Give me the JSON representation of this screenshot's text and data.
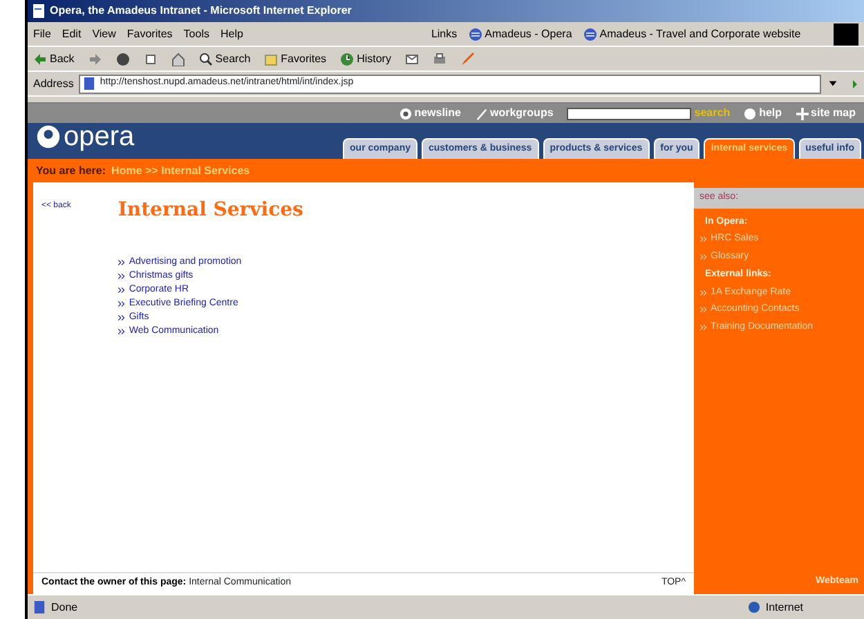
{
  "window": {
    "title": "Opera, the Amadeus Intranet - Microsoft Internet Explorer"
  },
  "menu": [
    "File",
    "Edit",
    "View",
    "Favorites",
    "Tools",
    "Help"
  ],
  "links_bar": {
    "label": "Links",
    "items": [
      "Amadeus - Opera",
      "Amadeus - Travel and Corporate website"
    ]
  },
  "toolbar": [
    {
      "kind": "back",
      "label": "Back"
    },
    {
      "kind": "forward"
    },
    {
      "kind": "stop"
    },
    {
      "kind": "refresh"
    },
    {
      "kind": "home"
    },
    {
      "kind": "search",
      "label": "Search"
    },
    {
      "kind": "favorites",
      "label": "Favorites"
    },
    {
      "kind": "history",
      "label": "History"
    },
    {
      "kind": "mail"
    },
    {
      "kind": "print"
    },
    {
      "kind": "edit"
    }
  ],
  "address": {
    "label": "Address",
    "value": "http://tenshost.nupd.amadeus.net/intranet/html/int/index.jsp"
  },
  "site": {
    "logo": "opera",
    "nav": [
      {
        "kind": "newsline",
        "label": "newsline"
      },
      {
        "kind": "workgroups",
        "label": "workgroups"
      },
      {
        "kind": "search",
        "label": "search"
      },
      {
        "kind": "help",
        "label": "help"
      },
      {
        "kind": "sitemap",
        "label": "site map"
      }
    ],
    "tabs": [
      {
        "label": "our company",
        "selected": false
      },
      {
        "label": "customers & business",
        "selected": false
      },
      {
        "label": "products & services",
        "selected": false
      },
      {
        "label": "for you",
        "selected": false
      },
      {
        "label": "internal services",
        "selected": true
      },
      {
        "label": "useful info",
        "selected": false
      }
    ],
    "breadcrumb": {
      "label": "You are here:",
      "path": "Home >> Internal Services"
    },
    "back_link": "<< back",
    "heading": "Internal Services",
    "services": [
      "Advertising and promotion",
      "Christmas gifts",
      "Corporate HR",
      "Executive Briefing Centre",
      "Gifts",
      "Web Communication"
    ],
    "sidebar": {
      "title": "see also:",
      "groups": [
        {
          "heading": "In Opera:",
          "links": [
            "HRC Sales",
            "Glossary"
          ]
        },
        {
          "heading": "External links:",
          "links": [
            "1A Exchange Rate",
            "Accounting Contacts",
            "Training Documentation"
          ]
        }
      ],
      "credit": "Webteam"
    },
    "footer": {
      "label": "Contact the owner of this page:",
      "link": "Internal Communication",
      "top": "TOP^"
    }
  },
  "status_bar": {
    "text": "Done",
    "zone": "Internet"
  }
}
